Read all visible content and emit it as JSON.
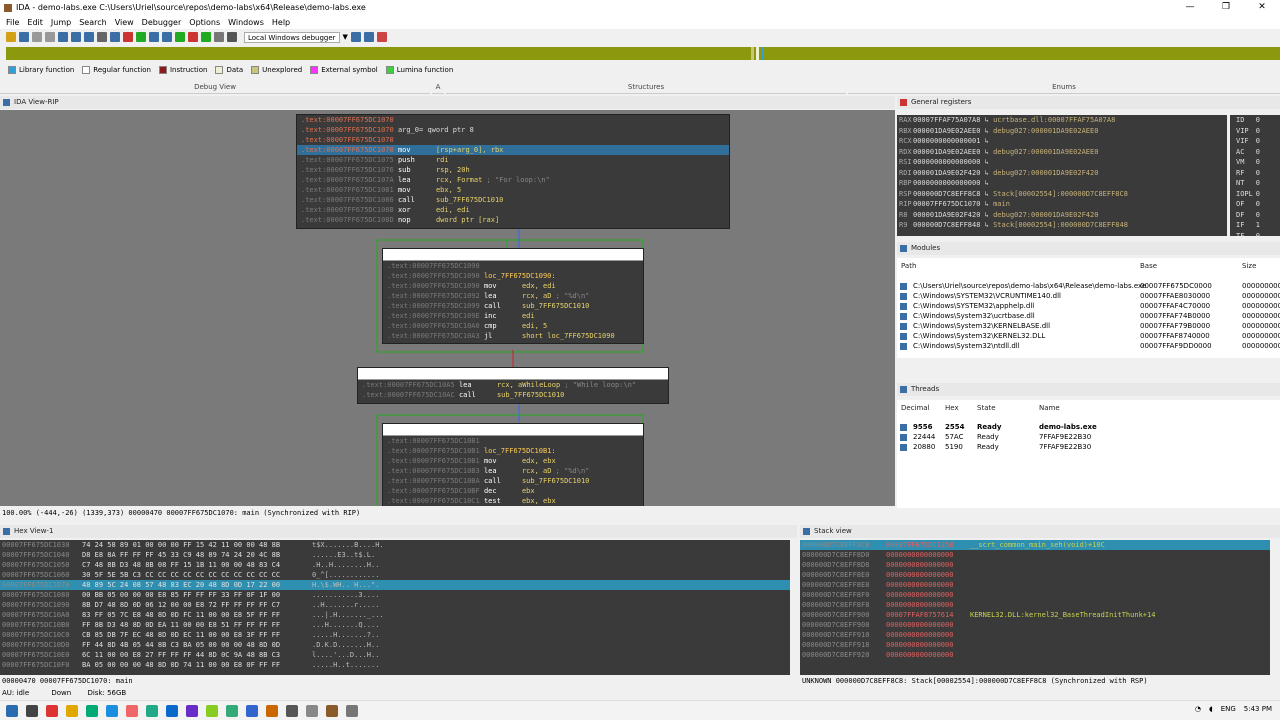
{
  "window": {
    "title": "IDA - demo-labs.exe C:\\Users\\Uriel\\source\\repos\\demo-labs\\x64\\Release\\demo-labs.exe",
    "controls": [
      "—",
      "❐",
      "✕"
    ]
  },
  "menu": [
    "File",
    "Edit",
    "Jump",
    "Search",
    "View",
    "Debugger",
    "Options",
    "Windows",
    "Help"
  ],
  "toolbar": {
    "debugger_select": "Local Windows debugger"
  },
  "legend": [
    {
      "label": "Library function",
      "color": "#2f9fd6"
    },
    {
      "label": "Regular function",
      "color": "#ffffff"
    },
    {
      "label": "Instruction",
      "color": "#8b1a1a"
    },
    {
      "label": "Data",
      "color": "#f0f0d0"
    },
    {
      "label": "Unexplored",
      "color": "#c9c57a"
    },
    {
      "label": "External symbol",
      "color": "#ff33ff"
    },
    {
      "label": "Lumina function",
      "color": "#3ad13a"
    }
  ],
  "tabs": {
    "debug_view": "Debug View",
    "structures": "Structures",
    "enums": "Enums",
    "tab_a": "A"
  },
  "ida_view": {
    "title": "IDA View-RIP"
  },
  "graph": {
    "block1": {
      "lines": [
        {
          "addr": ".text:00007FF675DC1070",
          "text": ""
        },
        {
          "addr": ".text:00007FF675DC1070",
          "text": "arg_0= qword ptr  8"
        },
        {
          "addr": ".text:00007FF675DC1070",
          "text": ""
        }
      ],
      "instrs": [
        {
          "addr": ".text:00007FF675DC1070",
          "mn": "mov",
          "op": "[rsp+arg_0], rbx",
          "cm": "",
          "sel": true
        },
        {
          "addr": ".text:00007FF675DC1075",
          "mn": "push",
          "op": "rdi",
          "cm": ""
        },
        {
          "addr": ".text:00007FF675DC1076",
          "mn": "sub",
          "op": "rsp, 20h",
          "cm": ""
        },
        {
          "addr": ".text:00007FF675DC107A",
          "mn": "lea",
          "op": "rcx, Format",
          "cm": "; \"For loop:\\n\""
        },
        {
          "addr": ".text:00007FF675DC1081",
          "mn": "mov",
          "op": "ebx, 5",
          "cm": ""
        },
        {
          "addr": ".text:00007FF675DC1086",
          "mn": "call",
          "op": "sub_7FF675DC1010",
          "cm": ""
        },
        {
          "addr": ".text:00007FF675DC108B",
          "mn": "xor",
          "op": "edi, edi",
          "cm": ""
        },
        {
          "addr": ".text:00007FF675DC108D",
          "mn": "nop",
          "op": "dword ptr [rax]",
          "cm": ""
        }
      ]
    },
    "block2": {
      "label": "loc_7FF675DC1090:",
      "instrs": [
        {
          "addr": ".text:00007FF675DC1090",
          "mn": "mov",
          "op": "edx, edi",
          "cm": ""
        },
        {
          "addr": ".text:00007FF675DC1092",
          "mn": "lea",
          "op": "rcx, aD",
          "cm": "; \"%d\\n\""
        },
        {
          "addr": ".text:00007FF675DC1099",
          "mn": "call",
          "op": "sub_7FF675DC1010",
          "cm": ""
        },
        {
          "addr": ".text:00007FF675DC109E",
          "mn": "inc",
          "op": "edi",
          "cm": ""
        },
        {
          "addr": ".text:00007FF675DC10A0",
          "mn": "cmp",
          "op": "edi, 5",
          "cm": ""
        },
        {
          "addr": ".text:00007FF675DC10A3",
          "mn": "jl",
          "op": "short loc_7FF675DC1090",
          "cm": ""
        }
      ]
    },
    "block3": {
      "instrs": [
        {
          "addr": ".text:00007FF675DC10A5",
          "mn": "lea",
          "op": "rcx, aWhileLoop",
          "cm": "; \"While loop:\\n\""
        },
        {
          "addr": ".text:00007FF675DC10AC",
          "mn": "call",
          "op": "sub_7FF675DC1010",
          "cm": ""
        }
      ]
    },
    "block4": {
      "label": "loc_7FF675DC10B1:",
      "instrs": [
        {
          "addr": ".text:00007FF675DC10B1",
          "mn": "mov",
          "op": "edx, ebx",
          "cm": ""
        },
        {
          "addr": ".text:00007FF675DC10B3",
          "mn": "lea",
          "op": "rcx, aD",
          "cm": "; \"%d\\n\""
        },
        {
          "addr": ".text:00007FF675DC10BA",
          "mn": "call",
          "op": "sub_7FF675DC1010",
          "cm": ""
        },
        {
          "addr": ".text:00007FF675DC10BF",
          "mn": "dec",
          "op": "ebx",
          "cm": ""
        },
        {
          "addr": ".text:00007FF675DC10C1",
          "mn": "test",
          "op": "ebx, ebx",
          "cm": ""
        }
      ]
    }
  },
  "graph_status": "100.00% (-444,-26) (1339,373) 00000470 00007FF675DC1070: main (Synchronized with RIP)",
  "registers": {
    "title": "General registers",
    "rows": [
      {
        "name": "RAX",
        "value": "00007FFAF75A07A8",
        "ref": "ucrtbase.dll:00007FFAF75A07A8"
      },
      {
        "name": "RBX",
        "value": "000001DA9E02AEE0",
        "ref": "debug027:000001DA9E02AEE0"
      },
      {
        "name": "RCX",
        "value": "0000000000000001",
        "ref": ""
      },
      {
        "name": "RDX",
        "value": "000001DA9E02AEE0",
        "ref": "debug027:000001DA9E02AEE0"
      },
      {
        "name": "RSI",
        "value": "0000000000000000",
        "ref": ""
      },
      {
        "name": "RDI",
        "value": "000001DA9E02F420",
        "ref": "debug027:000001DA9E02F420"
      },
      {
        "name": "RBP",
        "value": "0000000000000000",
        "ref": ""
      },
      {
        "name": "RSP",
        "value": "000000D7C8EFF8C8",
        "ref": "Stack[00002554]:000000D7C8EFF8C8"
      },
      {
        "name": "RIP",
        "value": "00007FF675DC1070",
        "ref": "main"
      },
      {
        "name": "R8",
        "value": "000001DA9E02F420",
        "ref": "debug027:000001DA9E02F420"
      },
      {
        "name": "R9",
        "value": "000000D7C8EFF848",
        "ref": "Stack[00002554]:000000D7C8EFF848"
      }
    ],
    "flags": [
      {
        "name": "ID",
        "value": "0"
      },
      {
        "name": "VIP",
        "value": "0"
      },
      {
        "name": "VIF",
        "value": "0"
      },
      {
        "name": "AC",
        "value": "0"
      },
      {
        "name": "VM",
        "value": "0"
      },
      {
        "name": "RF",
        "value": "0"
      },
      {
        "name": "NT",
        "value": "0"
      },
      {
        "name": "IOPL",
        "value": "0"
      },
      {
        "name": "OF",
        "value": "0"
      },
      {
        "name": "DF",
        "value": "0"
      },
      {
        "name": "IF",
        "value": "1"
      },
      {
        "name": "TF",
        "value": "0"
      }
    ]
  },
  "modules": {
    "title": "Modules",
    "columns": [
      "Path",
      "Base",
      "Size"
    ],
    "rows": [
      {
        "path": "C:\\Users\\Uriel\\source\\repos\\demo-labs\\x64\\Release\\demo-labs.exe",
        "base": "00007FF675DC0000",
        "size": "0000000000"
      },
      {
        "path": "C:\\Windows\\SYSTEM32\\VCRUNTIME140.dll",
        "base": "00007FFAE8030000",
        "size": "0000000000"
      },
      {
        "path": "C:\\Windows\\SYSTEM32\\apphelp.dll",
        "base": "00007FFAF4C70000",
        "size": "0000000000"
      },
      {
        "path": "C:\\Windows\\System32\\ucrtbase.dll",
        "base": "00007FFAF74B0000",
        "size": "0000000000"
      },
      {
        "path": "C:\\Windows\\System32\\KERNELBASE.dll",
        "base": "00007FFAF79B0000",
        "size": "0000000000"
      },
      {
        "path": "C:\\Windows\\System32\\KERNEL32.DLL",
        "base": "00007FFAF8740000",
        "size": "0000000000"
      },
      {
        "path": "C:\\Windows\\System32\\ntdll.dll",
        "base": "00007FFAF9DD0000",
        "size": "0000000000"
      }
    ]
  },
  "threads": {
    "title": "Threads",
    "columns": [
      "Decimal",
      "Hex",
      "State",
      "Name"
    ],
    "rows": [
      {
        "dec": "9556",
        "hex": "2554",
        "state": "Ready",
        "name": "demo-labs.exe",
        "bold": true
      },
      {
        "dec": "22444",
        "hex": "57AC",
        "state": "Ready",
        "name": "7FFAF9E22B30"
      },
      {
        "dec": "20880",
        "hex": "5190",
        "state": "Ready",
        "name": "7FFAF9E22B30"
      }
    ]
  },
  "hex_view": {
    "title": "Hex View-1",
    "rows": [
      {
        "a": "00007FF675DC1030",
        "b": "74 24 58 89 01 00 00 00  FF 15 42 11 00 00 48 8B",
        "c": "t$X.......B....H."
      },
      {
        "a": "00007FF675DC1040",
        "b": "D8 E8 8A FF FF FF 45 33  C9 48 89 74 24 20 4C 8B",
        "c": "......E3..t$.L."
      },
      {
        "a": "00007FF675DC1050",
        "b": "C7 48 8B D3 48 8B 08 FF  15 1B 11 00 00 48 83 C4",
        "c": ".H..H........H.."
      },
      {
        "a": "00007FF675DC1060",
        "b": "30 5F 5E 5B C3 CC CC CC  CC CC CC CC CC CC CC CC",
        "c": "0_^[............"
      },
      {
        "a": "00007FF675DC1070",
        "b": "48 89 5C 24 08 57 48 83  EC 20 48 8D 0D 17 22 00",
        "c": "H.\\$.WH.. H...\".",
        "sel": true
      },
      {
        "a": "00007FF675DC1080",
        "b": "00 BB 05 00 00 00 E8 85  FF FF FF 33 FF 0F 1F 00",
        "c": "...........3...."
      },
      {
        "a": "00007FF675DC1090",
        "b": "8B D7 48 8D 0D 06 12 00  00 E8 72 FF FF FF FF C7",
        "c": "..H.......r....."
      },
      {
        "a": "00007FF675DC10A0",
        "b": "83 FF 05 7C E8 48 8D 0D  FC 11 00 00 E8 5F FF FF",
        "c": "...|.H......._..."
      },
      {
        "a": "00007FF675DC10B0",
        "b": "FF 8B D3 48 8D 0D EA 11  00 00 E8 51 FF FF FF FF",
        "c": "...H.......Q...."
      },
      {
        "a": "00007FF675DC10C0",
        "b": "CB 85 DB 7F EC 48 8D 0D  EC 11 00 00 E8 3F FF FF",
        "c": ".....H.......?.."
      },
      {
        "a": "00007FF675DC10D0",
        "b": "FF 44 8D 4B 05 44 8B C3  BA 05 00 00 00 48 8D 0D",
        "c": ".D.K.D.......H.."
      },
      {
        "a": "00007FF675DC10E0",
        "b": "6C 11 00 00 E8 27 FF FF  FF 44 8D 0C 9A 48 8B C3",
        "c": "l....'...D...H.."
      },
      {
        "a": "00007FF675DC10F0",
        "b": "BA 05 00 00 00 48 8D 0D  74 11 00 00 E8 0F FF FF",
        "c": ".....H..t......."
      }
    ],
    "status": "00000470 00007FF675DC1070: main"
  },
  "stack_view": {
    "title": "Stack view",
    "rows": [
      {
        "a": "000000D7C8EFF8C8",
        "v": "00007FF675DC1258",
        "c": "__scrt_common_main_seh(void)+10C",
        "sel": true
      },
      {
        "a": "000000D7C8EFF8D0",
        "v": "0000000000000000",
        "c": ""
      },
      {
        "a": "000000D7C8EFF8D8",
        "v": "0000000000000000",
        "c": ""
      },
      {
        "a": "000000D7C8EFF8E0",
        "v": "0000000000000000",
        "c": ""
      },
      {
        "a": "000000D7C8EFF8E8",
        "v": "0000000000000000",
        "c": ""
      },
      {
        "a": "000000D7C8EFF8F0",
        "v": "0000000000000000",
        "c": ""
      },
      {
        "a": "000000D7C8EFF8F8",
        "v": "0000000000000000",
        "c": ""
      },
      {
        "a": "000000D7C8EFF900",
        "v": "00007FFAF8757614",
        "c": "KERNEL32.DLL:kernel32_BaseThreadInitThunk+14"
      },
      {
        "a": "000000D7C8EFF908",
        "v": "0000000000000000",
        "c": ""
      },
      {
        "a": "000000D7C8EFF910",
        "v": "0000000000000000",
        "c": ""
      },
      {
        "a": "000000D7C8EFF918",
        "v": "0000000000000000",
        "c": ""
      },
      {
        "a": "000000D7C8EFF920",
        "v": "0000000000000000",
        "c": ""
      }
    ],
    "status": "UNKNOWN 000000D7C8EFF8C8: Stack[00002554]:000000D7C8EFF8C8 (Synchronized with RSP)"
  },
  "ida_status": {
    "au": "AU:  idle",
    "dir": "Down",
    "disk": "Disk: 56GB"
  },
  "taskbar": {
    "time": "5:43 PM",
    "lang": "ENG"
  }
}
